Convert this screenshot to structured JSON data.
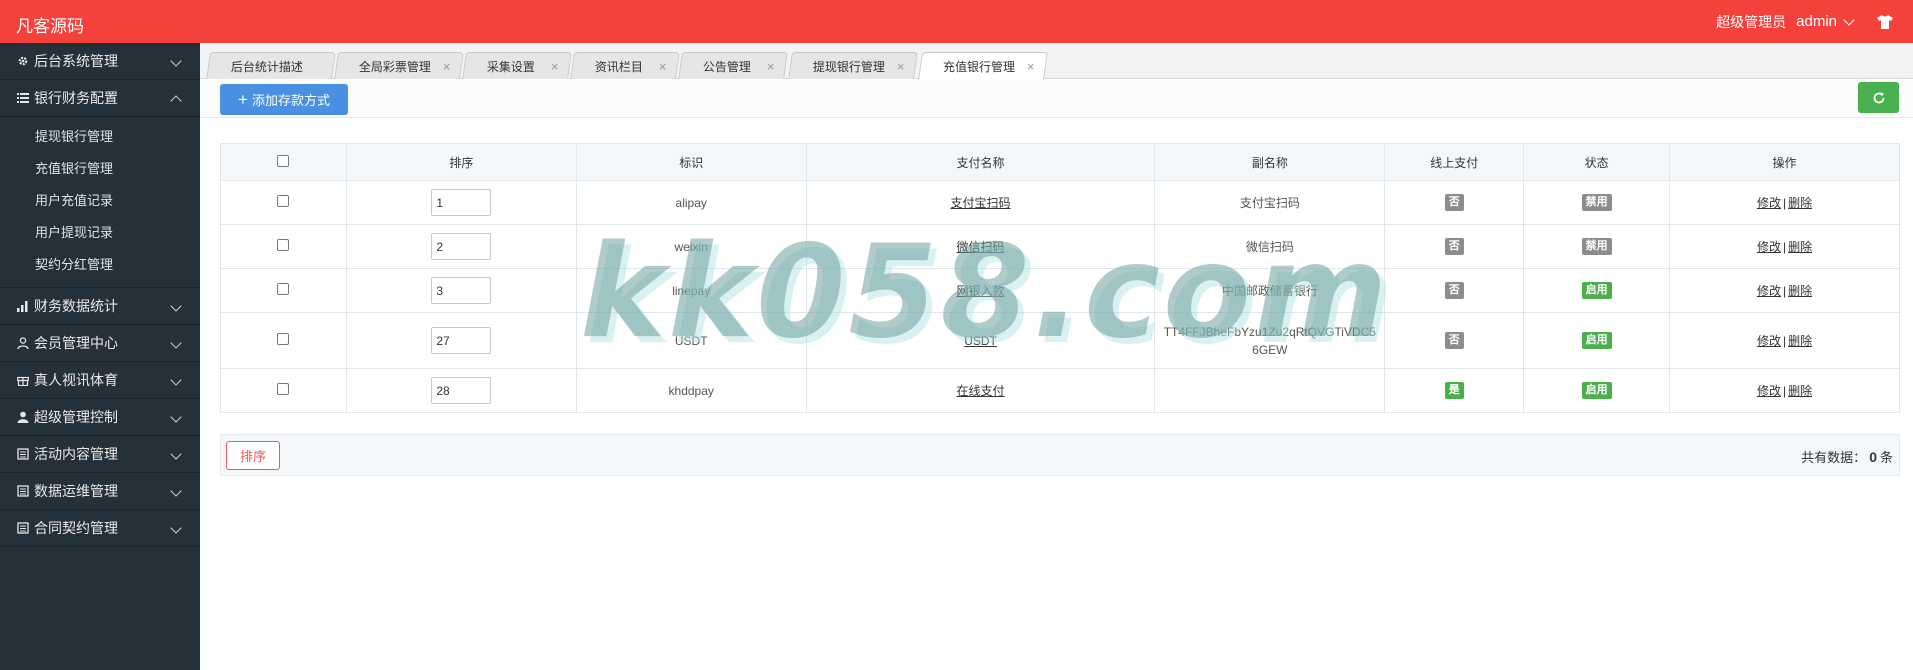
{
  "app": {
    "brand": "凡客源码"
  },
  "user": {
    "role": "超级管理员",
    "name": "admin"
  },
  "sidebar": {
    "items": [
      {
        "label": "后台系统管理",
        "icon": "gear-icon"
      },
      {
        "label": "银行财务配置",
        "icon": "list-icon",
        "expanded": true
      },
      {
        "label": "财务数据统计",
        "icon": "bar-chart-icon"
      },
      {
        "label": "会员管理中心",
        "icon": "user-icon"
      },
      {
        "label": "真人视讯体育",
        "icon": "gift-icon"
      },
      {
        "label": "超级管理控制",
        "icon": "user-solid-icon"
      },
      {
        "label": "活动内容管理",
        "icon": "document-icon"
      },
      {
        "label": "数据运维管理",
        "icon": "document-icon"
      },
      {
        "label": "合同契约管理",
        "icon": "document-icon"
      }
    ],
    "submenu": [
      "提现银行管理",
      "充值银行管理",
      "用户充值记录",
      "用户提现记录",
      "契约分红管理"
    ]
  },
  "tabs": [
    {
      "label": "后台统计描述",
      "closable": false
    },
    {
      "label": "全局彩票管理",
      "closable": true
    },
    {
      "label": "采集设置",
      "closable": true
    },
    {
      "label": "资讯栏目",
      "closable": true
    },
    {
      "label": "公告管理",
      "closable": true
    },
    {
      "label": "提现银行管理",
      "closable": true
    },
    {
      "label": "充值银行管理",
      "closable": true,
      "active": true
    }
  ],
  "toolbar": {
    "add_label": "添加存款方式"
  },
  "table": {
    "headers": [
      "排序",
      "标识",
      "支付名称",
      "副名称",
      "线上支付",
      "状态",
      "操作"
    ],
    "rows": [
      {
        "sort": "1",
        "id": "alipay",
        "name": "支付宝扫码",
        "subname": "支付宝扫码",
        "online": "否",
        "status": "禁用"
      },
      {
        "sort": "2",
        "id": "weixin",
        "name": "微信扫码",
        "subname": "微信扫码",
        "online": "否",
        "status": "禁用"
      },
      {
        "sort": "3",
        "id": "linepay",
        "name": "网银入款",
        "subname": "中国邮政储蓄银行",
        "online": "否",
        "status": "启用"
      },
      {
        "sort": "27",
        "id": "USDT",
        "name": "USDT",
        "subname": "TT4FFJBheFbYzu1Zu2qRtQVGTiVDC56GEW",
        "online": "否",
        "status": "启用"
      },
      {
        "sort": "28",
        "id": "khddpay",
        "name": "在线支付",
        "subname": "",
        "online": "是",
        "status": "启用"
      }
    ],
    "actions": {
      "edit": "修改",
      "sep": "|",
      "delete": "删除"
    }
  },
  "footer": {
    "sort_label": "排序",
    "total_prefix": "共有数据：",
    "total_count": "0",
    "total_suffix": "条"
  },
  "watermark": "kk058.com",
  "colors": {
    "topbar": "#f5413b",
    "sidebar": "#24303a",
    "primary": "#4a90e2",
    "success": "#48b04f",
    "badge_grey": "#8c8c8c",
    "badge_green": "#4cae4c"
  }
}
